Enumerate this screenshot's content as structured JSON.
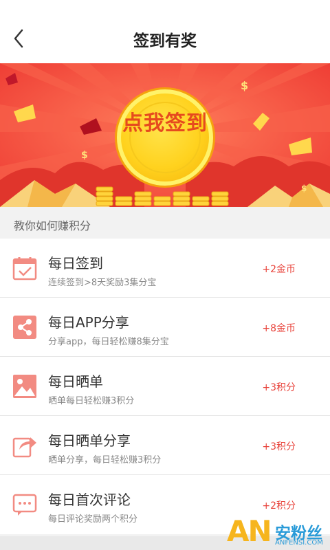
{
  "header": {
    "title": "签到有奖"
  },
  "banner": {
    "coin_text": "点我签到"
  },
  "section_label": "教你如何赚积分",
  "tasks": [
    {
      "title": "每日签到",
      "subtitle": "连续签到>8天奖励3集分宝",
      "reward": "+2金币",
      "icon": "calendar-check-icon"
    },
    {
      "title": "每日APP分享",
      "subtitle": "分享app，每日轻松赚8集分宝",
      "reward": "+8金币",
      "icon": "share-icon"
    },
    {
      "title": "每日晒单",
      "subtitle": "晒单每日轻松赚3积分",
      "reward": "+3积分",
      "icon": "image-icon"
    },
    {
      "title": "每日晒单分享",
      "subtitle": "晒单分享，每日轻松赚3积分",
      "reward": "+3积分",
      "icon": "forward-arrow-icon"
    },
    {
      "title": "每日首次评论",
      "subtitle": "每日评论奖励两个积分",
      "reward": "+2积分",
      "icon": "comment-icon"
    }
  ],
  "watermark": {
    "logo": "AN",
    "cn": "安粉丝",
    "en": "ANFENSI.COM"
  },
  "colors": {
    "accent": "#e8423a",
    "icon_pink": "#f28b82",
    "banner_red": "#f0453a",
    "coin_gold": "#ffd21e"
  }
}
